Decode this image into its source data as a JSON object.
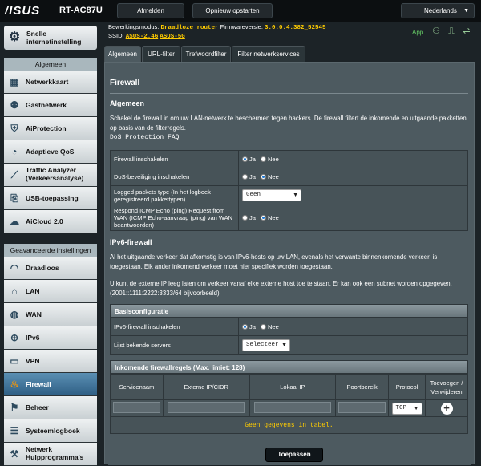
{
  "header": {
    "brand": "/ISUS",
    "model": "RT-AC87U",
    "logout_label": "Afmelden",
    "reboot_label": "Opnieuw opstarten",
    "language": "Nederlands"
  },
  "status": {
    "mode_label": "Bewerkingsmodus:",
    "mode_value": "Draadloze router",
    "firmware_label": "Firmwareversie:",
    "firmware_value": "3.0.0.4.382_52545",
    "ssid_label": "SSID:",
    "ssid_1": "ASUS-2.4G",
    "ssid_2": "ASUS-5G",
    "app_label": "App"
  },
  "sidebar": {
    "quick_setup": "Snelle internetinstelling",
    "general_header": "Algemeen",
    "general_items": [
      {
        "label": "Netwerkkaart",
        "icon": "network-map-icon"
      },
      {
        "label": "Gastnetwerk",
        "icon": "guest-network-icon"
      },
      {
        "label": "AiProtection",
        "icon": "shield-icon"
      },
      {
        "label": "Adaptieve QoS",
        "icon": "qos-gauge-icon"
      },
      {
        "label": "Traffic Analyzer (Verkeersanalyse)",
        "icon": "traffic-icon"
      },
      {
        "label": "USB-toepassing",
        "icon": "usb-icon"
      },
      {
        "label": "AiCloud 2.0",
        "icon": "cloud-icon"
      }
    ],
    "advanced_header": "Geavanceerde instellingen",
    "advanced_items": [
      {
        "label": "Draadloos",
        "icon": "wireless-icon"
      },
      {
        "label": "LAN",
        "icon": "lan-icon"
      },
      {
        "label": "WAN",
        "icon": "globe-icon"
      },
      {
        "label": "IPv6",
        "icon": "ipv6-icon"
      },
      {
        "label": "VPN",
        "icon": "vpn-icon"
      },
      {
        "label": "Firewall",
        "icon": "firewall-icon"
      },
      {
        "label": "Beheer",
        "icon": "admin-icon"
      },
      {
        "label": "Systeemlogboek",
        "icon": "log-icon"
      },
      {
        "label": "Netwerk Hulpprogramma's",
        "icon": "tools-icon"
      }
    ]
  },
  "tabs": [
    "Algemeen",
    "URL-filter",
    "Trefwoordfilter",
    "Filter netwerkservices"
  ],
  "page": {
    "title": "Firewall",
    "general_title": "Algemeen",
    "general_desc": "Schakel de firewall in om uw LAN-netwerk te beschermen tegen hackers. De firewall filtert de inkomende en uitgaande pakketten op basis van de filterregels.",
    "faq_link": "DoS Protection FAQ",
    "settings": [
      {
        "label": "Firewall inschakelen",
        "opt_yes": "Ja",
        "opt_no": "Nee"
      },
      {
        "label": "DoS-beveiliging inschakelen",
        "opt_yes": "Ja",
        "opt_no": "Nee"
      },
      {
        "label": "Logged packets type (In het logboek geregistreerd pakkettypen)",
        "select": "Geen"
      },
      {
        "label": "Respond ICMP Echo (ping) Request from WAN (ICMP Echo-aanvraag (ping) van WAN beantwoorden)",
        "opt_yes": "Ja",
        "opt_no": "Nee"
      }
    ],
    "ipv6_title": "IPv6-firewall",
    "ipv6_desc1": "Al het uitgaande verkeer dat afkomstig is van IPv6-hosts op uw LAN, evenals het verwante binnenkomende verkeer, is toegestaan. Elk ander inkomend verkeer moet hier specifiek worden toegestaan.",
    "ipv6_desc2": "U kunt de externe IP leeg laten om verkeer vanaf elke externe host toe te staan. Er kan ook een subnet worden opgegeven. (2001::1111:2222:3333/64 bijvoorbeeld)",
    "basic_header": "Basisconfiguratie",
    "ipv6_enable_label": "IPv6-firewall inschakelen",
    "ipv6_opt_yes": "Ja",
    "ipv6_opt_no": "Nee",
    "known_servers_label": "Lijst bekende servers",
    "known_servers_select": "Selecteer",
    "rules_header": "Inkomende firewallregels (Max. limiet: 128)",
    "rules_columns": [
      "Servicenaam",
      "Externe IP/CIDR",
      "Lokaal IP",
      "Poortbereik",
      "Protocol",
      "Toevoegen / Verwijderen"
    ],
    "protocol_value": "TCP",
    "empty_text": "Geen gegevens in tabel.",
    "apply_label": "Toepassen"
  }
}
